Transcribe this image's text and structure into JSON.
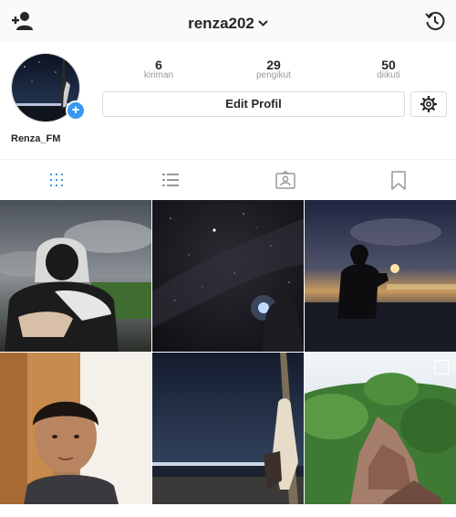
{
  "header": {
    "username": "renza202"
  },
  "profile": {
    "display_name": "Renza_FM",
    "stats": [
      {
        "value": "6",
        "label": "kiriman"
      },
      {
        "value": "29",
        "label": "pengikut"
      },
      {
        "value": "50",
        "label": "diikuti"
      }
    ],
    "edit_label": "Edit Profil"
  },
  "tabs": [
    "grid-icon",
    "list-icon",
    "tagged-icon",
    "saved-icon"
  ],
  "posts": [
    {
      "subject": "hooded person sitting under cloudy sky",
      "icon": "photo"
    },
    {
      "subject": "starry night sky with silhouette and flashlight",
      "icon": "photo"
    },
    {
      "subject": "silhouette holding moon at sunset",
      "icon": "photo"
    },
    {
      "subject": "selfie portrait indoors",
      "icon": "photo"
    },
    {
      "subject": "night harbor lights with person on pole",
      "icon": "photo"
    },
    {
      "subject": "green hill with rocks landscape",
      "icon": "photo",
      "multiple": true
    }
  ],
  "colors": {
    "accent": "#3897f0",
    "text": "#262626",
    "muted": "#999999",
    "border": "#dbdbdb"
  }
}
